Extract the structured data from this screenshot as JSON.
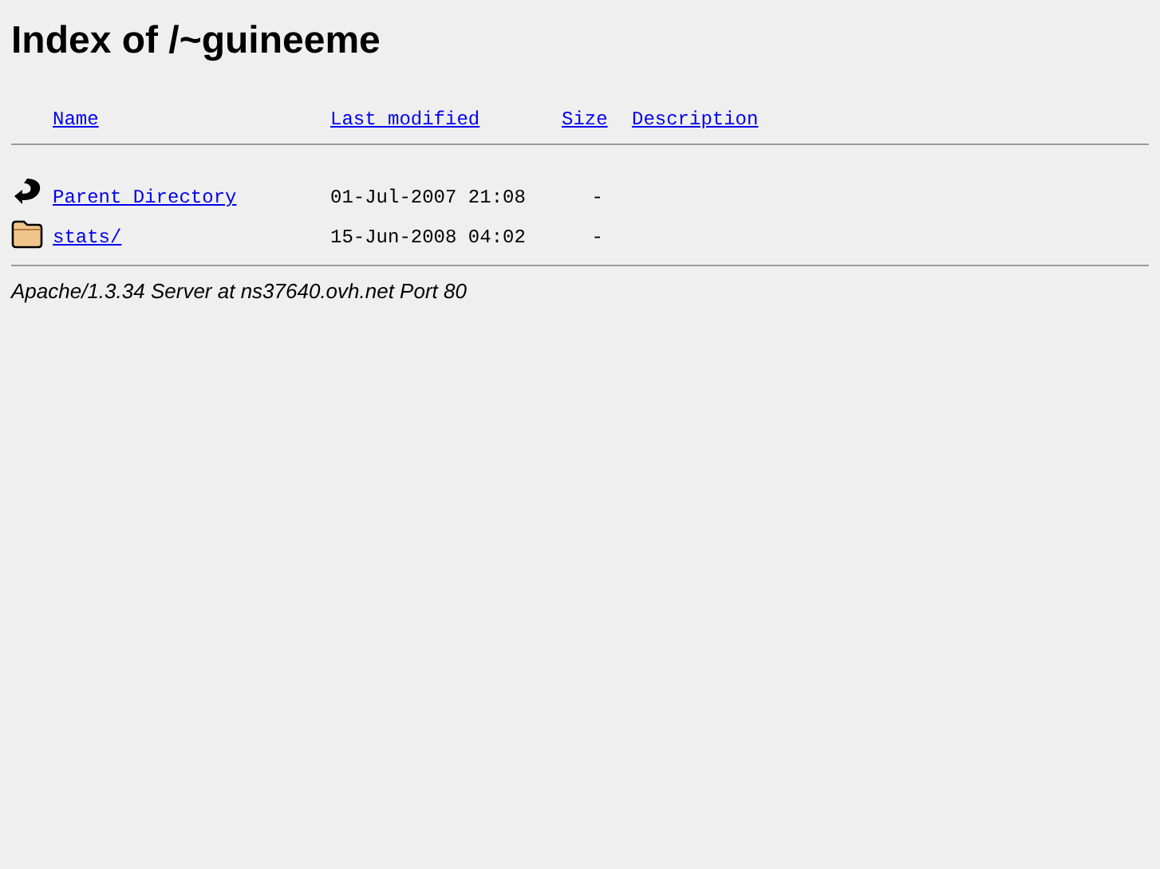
{
  "title": "Index of /~guineeme",
  "columns": [
    "Name",
    "Last modified",
    "Size",
    "Description"
  ],
  "rows": [
    {
      "kind": "back",
      "name": "Parent Directory",
      "modified": "01-Jul-2007 21:08",
      "size": "-"
    },
    {
      "kind": "folder",
      "name": "stats/",
      "modified": "15-Jun-2008 04:02",
      "size": "-"
    }
  ],
  "address": "Apache/1.3.34 Server at ns37640.ovh.net Port 80"
}
